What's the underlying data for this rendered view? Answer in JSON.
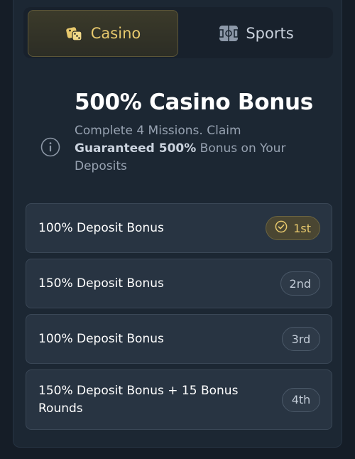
{
  "tabs": [
    {
      "label": "Casino",
      "icon": "dice-icon",
      "active": true
    },
    {
      "label": "Sports",
      "icon": "football-field-icon",
      "active": false
    }
  ],
  "bonus": {
    "title": "500% Casino Bonus",
    "desc_prefix": "Complete 4 Missions. Claim ",
    "desc_bold": "Guaranteed 500%",
    "desc_suffix": " Bonus on Your Deposits"
  },
  "missions": [
    {
      "label": "100% Deposit Bonus",
      "badge": "1st",
      "completed": true
    },
    {
      "label": "150% Deposit Bonus",
      "badge": "2nd",
      "completed": false
    },
    {
      "label": "100% Deposit Bonus",
      "badge": "3rd",
      "completed": false
    },
    {
      "label": "150% Deposit Bonus + 15 Bonus Rounds",
      "badge": "4th",
      "completed": false
    }
  ],
  "colors": {
    "accent_gold": "#e8c96d",
    "background": "#151d27",
    "panel": "#1c2733",
    "card": "#283442"
  }
}
